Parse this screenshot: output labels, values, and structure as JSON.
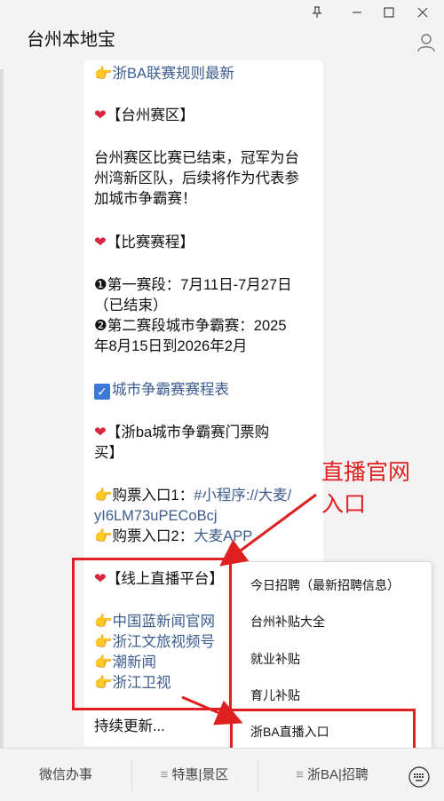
{
  "app": {
    "title": "台州本地宝"
  },
  "chat": {
    "lines": {
      "rules": "浙BA联赛规则最新",
      "section_taizhou": "【台州赛区】",
      "taizhou_p1": "台州赛区比赛已结束，冠军为台",
      "taizhou_p2": "州湾新区队，后续将作为代表参",
      "taizhou_p3": "加城市争霸赛！",
      "section_schedule": "【比赛赛程】",
      "stage1_a": "❶第一赛段：7月11日-7月27日",
      "stage1_b": "（已结束）",
      "stage2_a": "❷第二赛段城市争霸赛：2025",
      "stage2_b": "年8月15日到2026年2月",
      "schedule_table": "城市争霸赛赛程表",
      "section_tickets_a": "【浙ba城市争霸赛门票购",
      "section_tickets_b": "买】",
      "ticket1_label": "购票入口1：",
      "ticket1_link_a": "#小程序://大麦/",
      "ticket1_link_b": "yI6LM73uPECoBcj",
      "ticket2_label": "购票入口2：",
      "ticket2_link": "大麦APP",
      "section_live": "【线上直播平台】",
      "live1": "中国蓝新闻官网",
      "live2": "浙江文旅视频号",
      "live3": "潮新闻",
      "live4": "浙江卫视",
      "more": "持续更新..."
    }
  },
  "annotation": {
    "line1": "直播官网",
    "line2": "入口"
  },
  "menu": {
    "items": [
      "今日招聘（最新招聘信息）",
      "台州补贴大全",
      "就业补贴",
      "育儿补贴",
      "浙BA直播入口"
    ]
  },
  "bottom_tabs": [
    "微信办事",
    "特惠|景区",
    "浙BA|招聘"
  ],
  "colors": {
    "link": "#3d5d8f",
    "annotation": "#e02020",
    "heart": "#d7263d"
  },
  "icons": [
    "pin-icon",
    "minimize-icon",
    "maximize-icon",
    "close-icon",
    "user-icon",
    "heart-icon",
    "pointing-hand-icon",
    "checkbox-icon",
    "menu-lines-icon",
    "keyboard-icon"
  ]
}
